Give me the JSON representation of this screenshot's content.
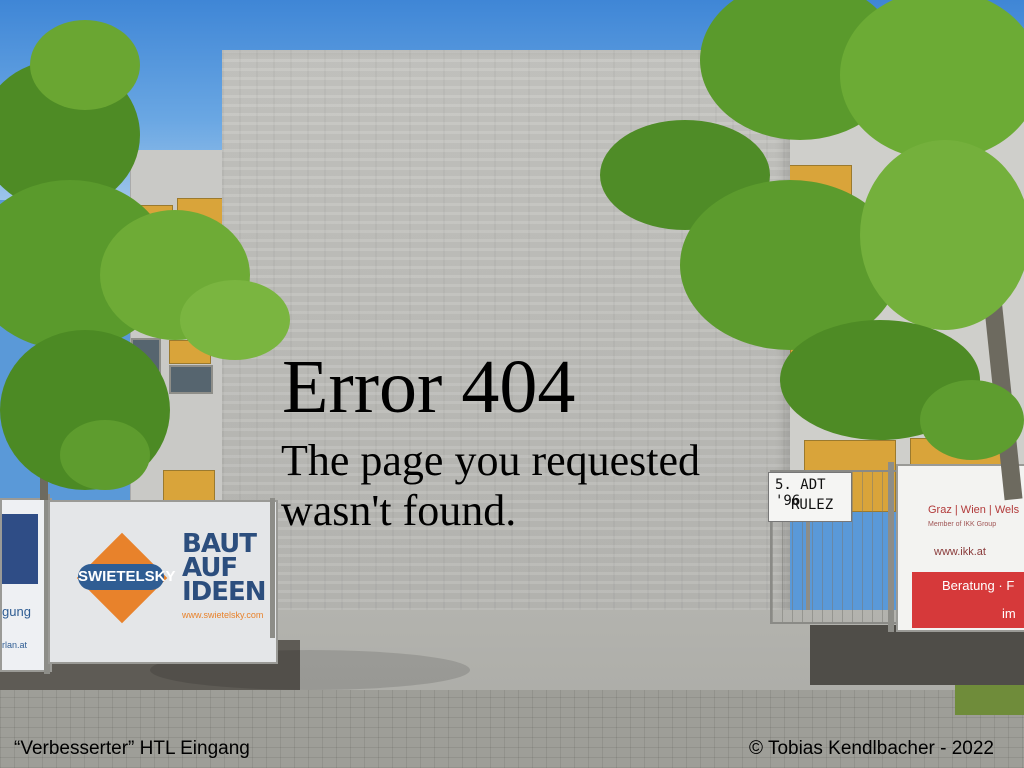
{
  "error": {
    "title": "Error 404",
    "message": "The page you requested wasn't found."
  },
  "captions": {
    "left": "“Verbesserter” HTL Eingang",
    "right": "© Tobias Kendlbacher - 2022"
  },
  "photo": {
    "banner_left_logo": "SWIETELSKY",
    "banner_left_slogan_1": "BAUT",
    "banner_left_slogan_2": "AUF",
    "banner_left_slogan_3": "IDEEN",
    "banner_left_url": "www.swietelsky.com",
    "far_left_banner_text": "gung",
    "far_left_banner_url": "rlan.at",
    "sign_line_1": "5. ADT '96",
    "sign_line_2": "RULEZ",
    "banner_right_cities": "Graz | Wien | Wels",
    "banner_right_group": "Member of IKK Group",
    "banner_right_url": "www.ikk.at",
    "banner_right_red": "Beratung · F",
    "banner_right_red_2": "im"
  },
  "colors": {
    "sky": "#3f86d6",
    "concrete": "#bdbdb9",
    "foliage": "#5f9a2e",
    "swietelsky_orange": "#e8822b",
    "swietelsky_blue": "#2f5d93",
    "ikk_red": "#d6393a"
  }
}
